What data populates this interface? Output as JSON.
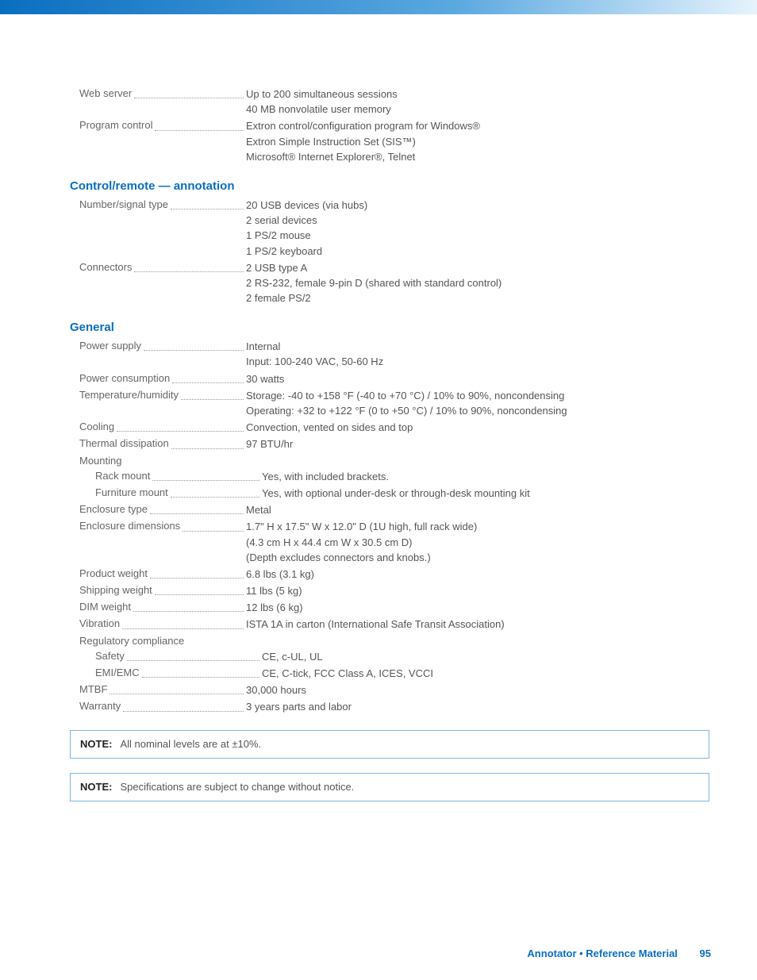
{
  "top": {
    "web_server": {
      "label": "Web server",
      "v1": "Up to 200 simultaneous sessions",
      "v2": "40 MB nonvolatile user memory"
    },
    "program_control": {
      "label": "Program control",
      "v1": "Extron control/configuration program for Windows®",
      "v2": "Extron Simple Instruction Set (SIS™)",
      "v3": "Microsoft® Internet Explorer®, Telnet"
    }
  },
  "s1": {
    "title": "Control/remote — annotation",
    "num_signal": {
      "label": "Number/signal type",
      "v1": "20 USB devices (via hubs)",
      "v2": "2 serial devices",
      "v3": "1 PS/2 mouse",
      "v4": "1 PS/2 keyboard"
    },
    "connectors": {
      "label": "Connectors",
      "v1": "2 USB type A",
      "v2": "2 RS-232, female 9-pin D (shared with standard control)",
      "v3": "2 female PS/2"
    }
  },
  "s2": {
    "title": "General",
    "power_supply": {
      "label": "Power supply",
      "v1": "Internal",
      "v2": "Input: 100-240 VAC, 50-60 Hz"
    },
    "power_cons": {
      "label": "Power consumption",
      "v1": "30 watts"
    },
    "temp": {
      "label": "Temperature/humidity",
      "v1": "Storage: -40 to +158 °F (-40 to +70 °C) / 10% to 90%, noncondensing",
      "v2": "Operating: +32 to +122 °F (0 to +50 °C) / 10% to 90%, noncondensing"
    },
    "cooling": {
      "label": "Cooling",
      "v1": "Convection, vented on sides and top"
    },
    "thermal": {
      "label": "Thermal dissipation",
      "v1": "97 BTU/hr"
    },
    "mounting": {
      "label": "Mounting"
    },
    "rack": {
      "label": "Rack mount",
      "v1": "Yes, with included brackets."
    },
    "furn": {
      "label": "Furniture mount",
      "v1": "Yes, with optional under-desk or through-desk mounting kit"
    },
    "encl_type": {
      "label": "Enclosure type",
      "v1": "Metal"
    },
    "encl_dim": {
      "label": "Enclosure dimensions",
      "v1": "1.7\" H x 17.5\" W x 12.0\" D  (1U high, full rack wide)",
      "v2": "(4.3 cm H x 44.4 cm W x 30.5 cm D)",
      "v3": "(Depth excludes connectors and knobs.)"
    },
    "prod_wt": {
      "label": "Product weight",
      "v1": "6.8 lbs (3.1 kg)"
    },
    "ship_wt": {
      "label": "Shipping weight",
      "v1": "11 lbs (5 kg)"
    },
    "dim_wt": {
      "label": "DIM weight",
      "v1": "12 lbs (6 kg)"
    },
    "vib": {
      "label": "Vibration",
      "v1": "ISTA 1A in carton (International Safe Transit Association)"
    },
    "reg": {
      "label": "Regulatory compliance"
    },
    "safety": {
      "label": "Safety",
      "v1": "CE, c-UL, UL"
    },
    "emi": {
      "label": "EMI/EMC",
      "v1": "CE, C-tick, FCC Class A, ICES, VCCI"
    },
    "mtbf": {
      "label": "MTBF",
      "v1": "30,000 hours"
    },
    "warr": {
      "label": "Warranty",
      "v1": "3 years parts and labor"
    }
  },
  "notes": {
    "label": "NOTE:",
    "n1": "All nominal levels are at ±10%.",
    "n2": "Specifications are subject to change without notice."
  },
  "footer": {
    "t1": "Annotator • Reference Material",
    "t2": "95"
  }
}
